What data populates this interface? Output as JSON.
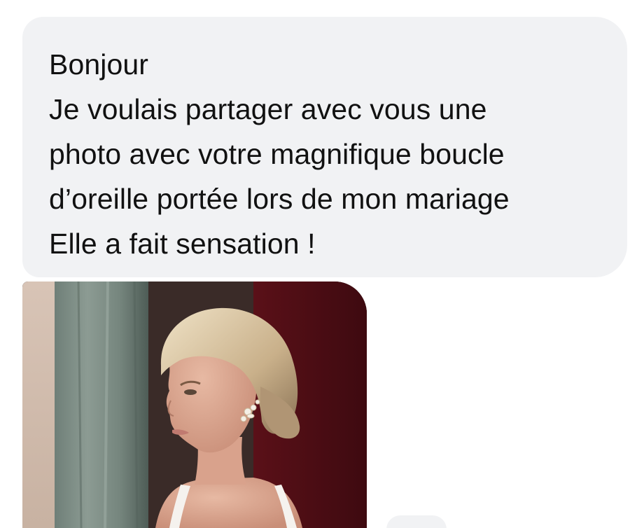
{
  "message": {
    "lines": [
      "Bonjour",
      "Je voulais partager avec vous une",
      "photo avec votre magnifique boucle",
      "d’oreille portée lors de mon mariage",
      "Elle a fait sensation !"
    ]
  },
  "attachment": {
    "icon": "photo-attachment",
    "colors": {
      "bubble": "#f1f2f4",
      "text": "#111111"
    }
  }
}
